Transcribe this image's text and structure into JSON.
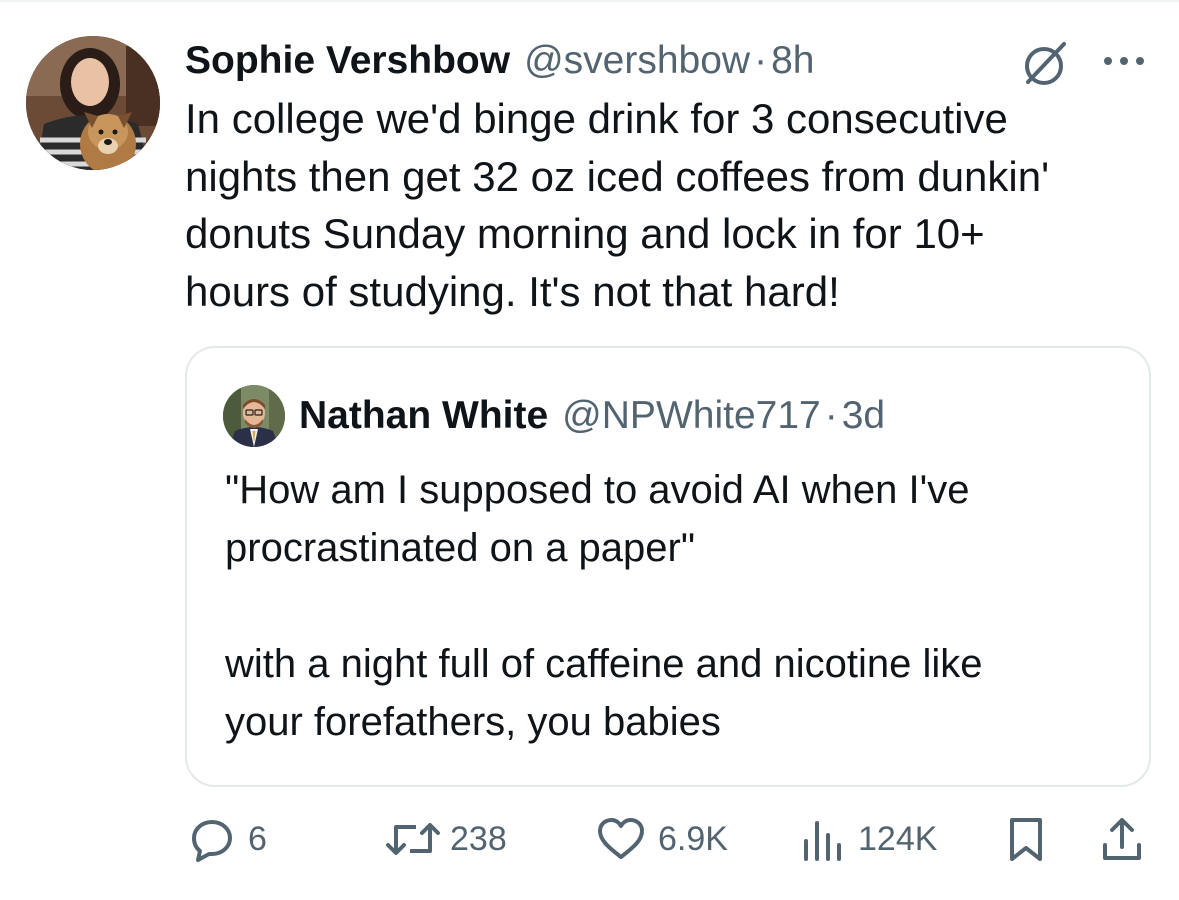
{
  "tweet": {
    "author_name": "Sophie Vershbow",
    "author_handle": "@svershbow",
    "separator": "·",
    "time": "8h",
    "text_lines": [
      "In college we'd binge drink for 3 consecutive",
      "nights then get 32 oz iced coffees from dunkin'",
      "donuts Sunday morning and lock in for 10+",
      "hours of studying. It's not that hard!"
    ]
  },
  "quote": {
    "author_name": "Nathan White",
    "author_handle": "@NPWhite717",
    "separator": "·",
    "time": "3d",
    "text_lines": [
      "\"How am I supposed to avoid AI when I've",
      "procrastinated on a paper\"",
      "",
      "with a night full of caffeine and nicotine like",
      "your forefathers, you babies"
    ]
  },
  "actions": {
    "replies": "6",
    "reposts": "238",
    "likes": "6.9K",
    "views": "124K"
  },
  "icons": {
    "grok": "grok-icon",
    "more": "more-icon",
    "reply": "reply-icon",
    "repost": "repost-icon",
    "like": "heart-icon",
    "views": "views-icon",
    "bookmark": "bookmark-icon",
    "share": "share-icon"
  },
  "colors": {
    "text": "#0f1419",
    "secondary": "#536471",
    "border": "#e3e8eb"
  }
}
